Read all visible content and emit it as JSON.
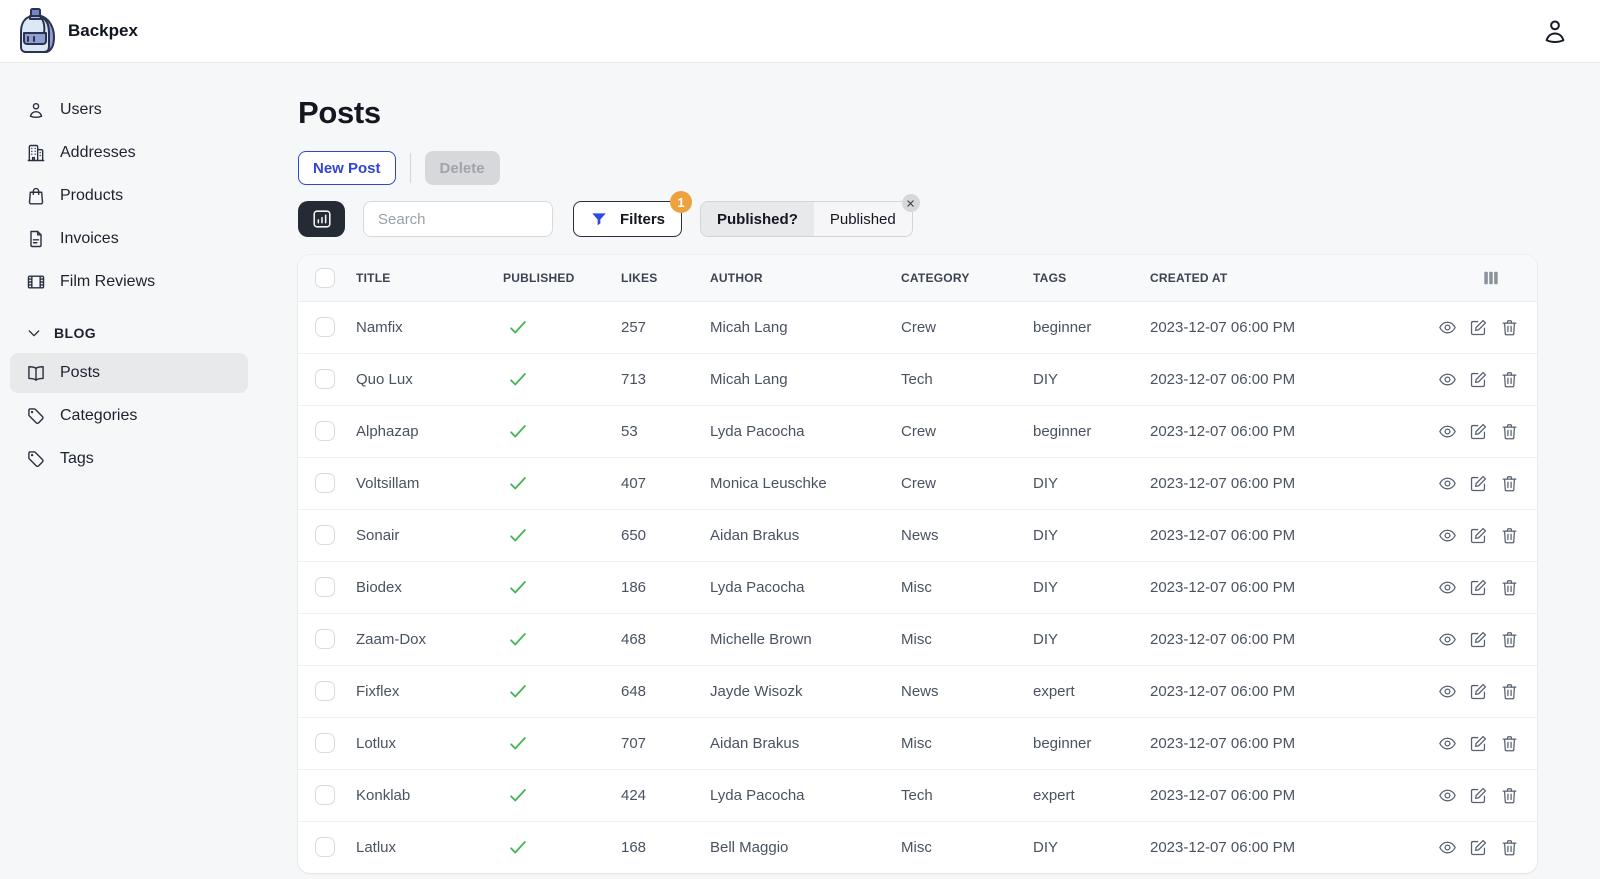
{
  "topbar": {
    "brand": "Backpex"
  },
  "sidebar": {
    "items": [
      {
        "label": "Users",
        "icon": "user-icon"
      },
      {
        "label": "Addresses",
        "icon": "building-icon"
      },
      {
        "label": "Products",
        "icon": "shopping-bag-icon"
      },
      {
        "label": "Invoices",
        "icon": "document-icon"
      },
      {
        "label": "Film Reviews",
        "icon": "film-icon"
      }
    ],
    "section_label": "BLOG",
    "blog_items": [
      {
        "label": "Posts",
        "icon": "book-open-icon",
        "active": true
      },
      {
        "label": "Categories",
        "icon": "tag-icon",
        "active": false
      },
      {
        "label": "Tags",
        "icon": "tag-icon",
        "active": false
      }
    ]
  },
  "main": {
    "title": "Posts",
    "toolbar": {
      "new_post_label": "New Post",
      "delete_label": "Delete"
    },
    "controls": {
      "search_placeholder": "Search",
      "filters_label": "Filters",
      "filters_badge": "1",
      "active_filter": {
        "name": "Published?",
        "value": "Published"
      }
    },
    "table": {
      "columns": [
        "TITLE",
        "PUBLISHED",
        "LIKES",
        "AUTHOR",
        "CATEGORY",
        "TAGS",
        "CREATED AT"
      ],
      "rows": [
        {
          "title": "Namfix",
          "published": true,
          "likes": "257",
          "author": "Micah Lang",
          "category": "Crew",
          "tags": "beginner",
          "created_at": "2023-12-07 06:00 PM"
        },
        {
          "title": "Quo Lux",
          "published": true,
          "likes": "713",
          "author": "Micah Lang",
          "category": "Tech",
          "tags": "DIY",
          "created_at": "2023-12-07 06:00 PM"
        },
        {
          "title": "Alphazap",
          "published": true,
          "likes": "53",
          "author": "Lyda Pacocha",
          "category": "Crew",
          "tags": "beginner",
          "created_at": "2023-12-07 06:00 PM"
        },
        {
          "title": "Voltsillam",
          "published": true,
          "likes": "407",
          "author": "Monica Leuschke",
          "category": "Crew",
          "tags": "DIY",
          "created_at": "2023-12-07 06:00 PM"
        },
        {
          "title": "Sonair",
          "published": true,
          "likes": "650",
          "author": "Aidan Brakus",
          "category": "News",
          "tags": "DIY",
          "created_at": "2023-12-07 06:00 PM"
        },
        {
          "title": "Biodex",
          "published": true,
          "likes": "186",
          "author": "Lyda Pacocha",
          "category": "Misc",
          "tags": "DIY",
          "created_at": "2023-12-07 06:00 PM"
        },
        {
          "title": "Zaam-Dox",
          "published": true,
          "likes": "468",
          "author": "Michelle Brown",
          "category": "Misc",
          "tags": "DIY",
          "created_at": "2023-12-07 06:00 PM"
        },
        {
          "title": "Fixflex",
          "published": true,
          "likes": "648",
          "author": "Jayde Wisozk",
          "category": "News",
          "tags": "expert",
          "created_at": "2023-12-07 06:00 PM"
        },
        {
          "title": "Lotlux",
          "published": true,
          "likes": "707",
          "author": "Aidan Brakus",
          "category": "Misc",
          "tags": "beginner",
          "created_at": "2023-12-07 06:00 PM"
        },
        {
          "title": "Konklab",
          "published": true,
          "likes": "424",
          "author": "Lyda Pacocha",
          "category": "Tech",
          "tags": "expert",
          "created_at": "2023-12-07 06:00 PM"
        },
        {
          "title": "Latlux",
          "published": true,
          "likes": "168",
          "author": "Bell Maggio",
          "category": "Misc",
          "tags": "DIY",
          "created_at": "2023-12-07 06:00 PM"
        }
      ]
    }
  },
  "colors": {
    "accent_blue": "#3246d3",
    "funnel_blue": "#2c49e4",
    "badge_orange": "#eea23e",
    "success_green": "#49b357",
    "dark_button": "#252b35",
    "page_bg": "#f6f7f8",
    "active_item_bg": "#e8e9eb"
  }
}
